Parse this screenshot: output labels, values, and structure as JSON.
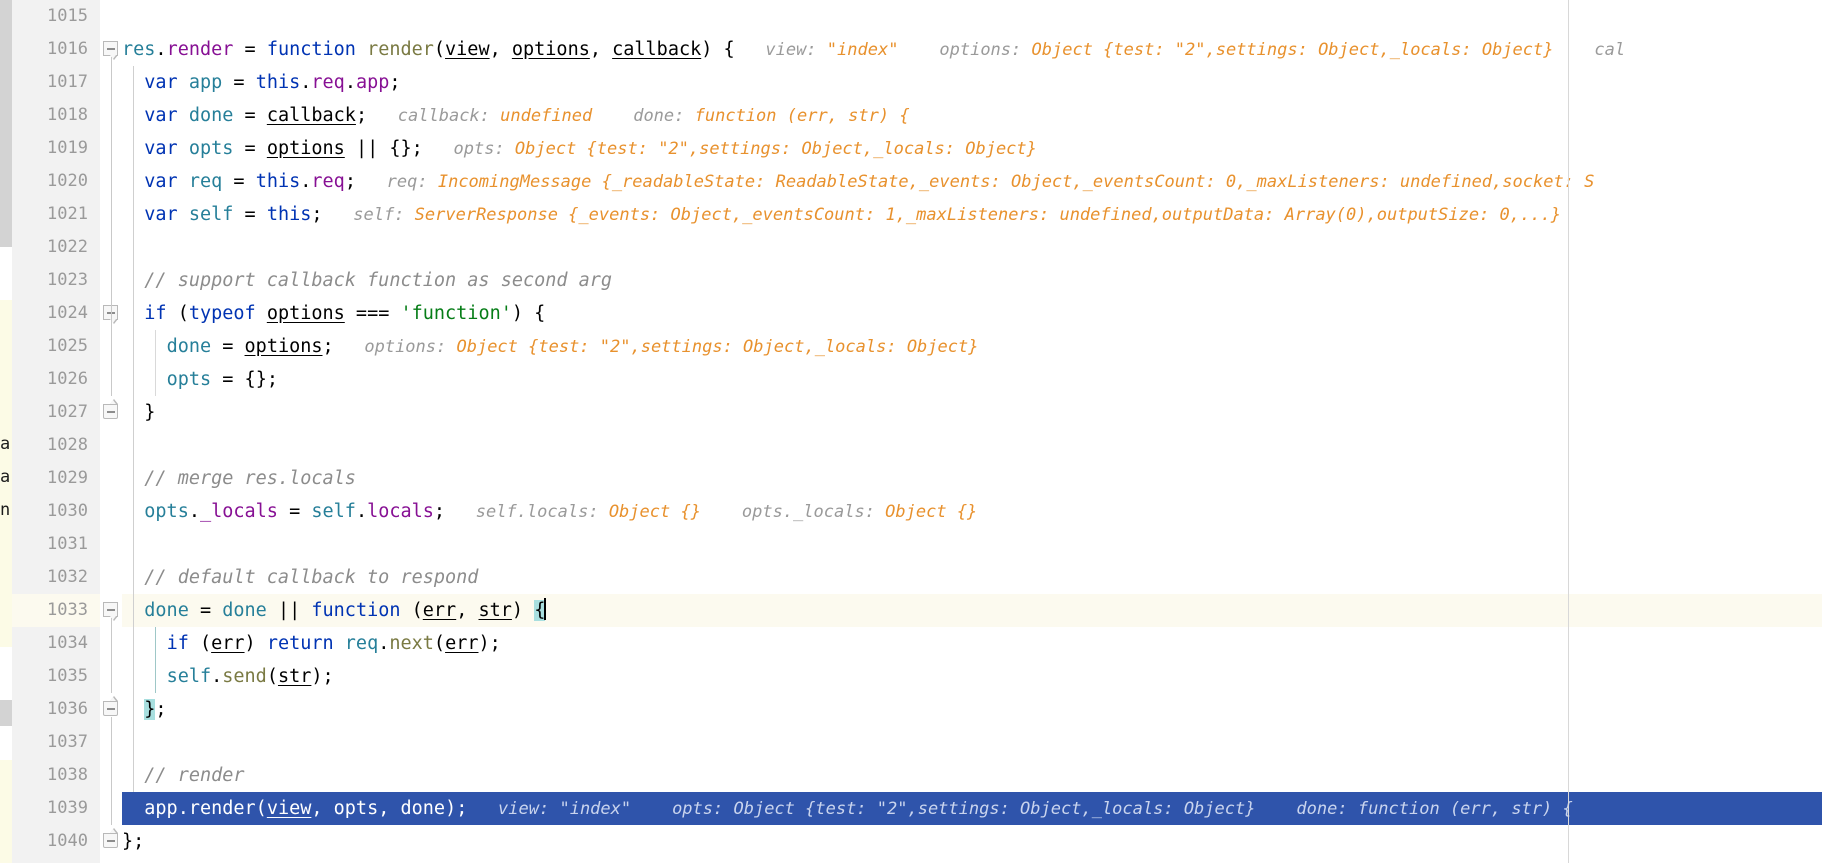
{
  "editor": {
    "language": "JavaScript",
    "first_line_number": 1015,
    "caret_line": 1033,
    "selected_line": 1039,
    "right_margin_column_x": 1568,
    "colors": {
      "keyword": "#0033b3",
      "member": "#871094",
      "function_name": "#7a7a43",
      "local_variable": "#267f99",
      "string": "#067d17",
      "comment": "#8c8c8c",
      "inlay_label": "#9a9a9a",
      "inlay_value": "#e8912d",
      "caret_row_bg": "#fcfaef",
      "selection_bg": "#2f54ab",
      "brace_match_bg": "#a8dfdf",
      "gutter_bg": "#f2f2f2",
      "line_number": "#9a9a9a"
    },
    "line_numbers": [
      "1015",
      "1016",
      "1017",
      "1018",
      "1019",
      "1020",
      "1021",
      "1022",
      "1023",
      "1024",
      "1025",
      "1026",
      "1027",
      "1028",
      "1029",
      "1030",
      "1031",
      "1032",
      "1033",
      "1034",
      "1035",
      "1036",
      "1037",
      "1038",
      "1039",
      "1040"
    ],
    "lines": [
      {
        "n": "1015",
        "code": "",
        "hints": []
      },
      {
        "n": "1016",
        "code": "res.render = function render(view, options, callback) {",
        "fold": true,
        "hints": [
          {
            "label": "view:",
            "value": "\"index\""
          },
          {
            "label": "options:",
            "value": "Object {test: \"2\",settings: Object,_locals: Object}"
          },
          {
            "label": "cal",
            "value": ""
          }
        ]
      },
      {
        "n": "1017",
        "code": "  var app = this.req.app;",
        "hints": []
      },
      {
        "n": "1018",
        "code": "  var done = callback;",
        "hints": [
          {
            "label": "callback:",
            "value": "undefined"
          },
          {
            "label": "done:",
            "value": "function (err, str) {"
          }
        ]
      },
      {
        "n": "1019",
        "code": "  var opts = options || {};",
        "hints": [
          {
            "label": "opts:",
            "value": "Object {test: \"2\",settings: Object,_locals: Object}"
          }
        ]
      },
      {
        "n": "1020",
        "code": "  var req = this.req;",
        "hints": [
          {
            "label": "req:",
            "value": "IncomingMessage {_readableState: ReadableState,_events: Object,_eventsCount: 0,_maxListeners: undefined,socket: S"
          }
        ]
      },
      {
        "n": "1021",
        "code": "  var self = this;",
        "hints": [
          {
            "label": "self:",
            "value": "ServerResponse {_events: Object,_eventsCount: 1,_maxListeners: undefined,outputData: Array(0),outputSize: 0,...}"
          }
        ]
      },
      {
        "n": "1022",
        "code": "",
        "hints": []
      },
      {
        "n": "1023",
        "code": "  // support callback function as second arg",
        "hints": []
      },
      {
        "n": "1024",
        "code": "  if (typeof options === 'function') {",
        "fold": true,
        "hints": []
      },
      {
        "n": "1025",
        "code": "    done = options;",
        "hints": [
          {
            "label": "options:",
            "value": "Object {test: \"2\",settings: Object,_locals: Object}"
          }
        ]
      },
      {
        "n": "1026",
        "code": "    opts = {};",
        "hints": []
      },
      {
        "n": "1027",
        "code": "  }",
        "fold": true,
        "hints": []
      },
      {
        "n": "1028",
        "code": "",
        "hints": []
      },
      {
        "n": "1029",
        "code": "  // merge res.locals",
        "hints": []
      },
      {
        "n": "1030",
        "code": "  opts._locals = self.locals;",
        "hints": [
          {
            "label": "self.locals:",
            "value": "Object {}"
          },
          {
            "label": "opts._locals:",
            "value": "Object {}"
          }
        ]
      },
      {
        "n": "1031",
        "code": "",
        "hints": []
      },
      {
        "n": "1032",
        "code": "  // default callback to respond",
        "hints": []
      },
      {
        "n": "1033",
        "code": "  done = done || function (err, str) {",
        "fold": true,
        "caret": true,
        "hints": []
      },
      {
        "n": "1034",
        "code": "    if (err) return req.next(err);",
        "hints": []
      },
      {
        "n": "1035",
        "code": "    self.send(str);",
        "hints": []
      },
      {
        "n": "1036",
        "code": "  };",
        "fold": true,
        "hints": []
      },
      {
        "n": "1037",
        "code": "",
        "hints": []
      },
      {
        "n": "1038",
        "code": "  // render",
        "hints": []
      },
      {
        "n": "1039",
        "code": "  app.render(view, opts, done);",
        "selected": true,
        "hints": [
          {
            "label": "view:",
            "value": "\"index\""
          },
          {
            "label": "opts:",
            "value": "Object {test: \"2\",settings: Object,_locals: Object}"
          },
          {
            "label": "done:",
            "value": "function (err, str) {"
          }
        ]
      },
      {
        "n": "1040",
        "code": "};",
        "fold": true,
        "hints": []
      }
    ]
  },
  "left_panel_sliver": {
    "fragments": [
      "a",
      "ar",
      "ns"
    ]
  }
}
